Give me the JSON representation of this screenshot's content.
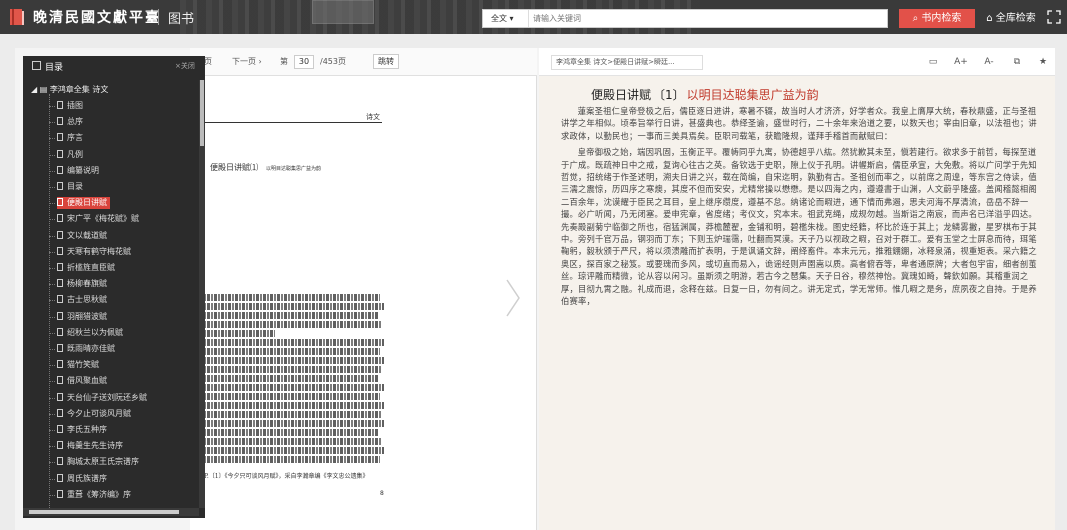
{
  "header": {
    "site_title": "晚清民國文獻平臺",
    "site_sub": "图书",
    "search_scope": "全文 ▾",
    "search_placeholder": "请输入关键词",
    "btn_search_book": "书内检索",
    "btn_search_all": "全库检索"
  },
  "reader": {
    "prev_label": "页",
    "next_label": "下一页 ›",
    "page_prefix": "第",
    "page_value": "30",
    "page_total": "/453页",
    "jump_label": "跳转"
  },
  "scan": {
    "header_text": "诗文",
    "title_text": "便殿日讲赋⑴",
    "subtitle_text": "以明目达聪集思广益为韵",
    "footnote": "P.〔1〕《今夕只可谈风月赋》，采自李瀚章编《李文忠公遗集》",
    "page_no": "8"
  },
  "text": {
    "breadcrumb": "李鸿章全集 诗文>便殿日讲赋>瞬廷...",
    "font_up": "A+",
    "font_down": "A-",
    "title_main": "便殿日讲赋",
    "title_ref": "〔1〕",
    "title_rhyme": "以明目达聪集思广益为韵",
    "paragraphs": [
      "蓮案圣祖仁皇帝登极之后，儒臣逐日进讲，寒暑不辍，故当时人才济济，好学者众。我皇上膺厚大统，春秋鼎盛，正与圣祖讲学之年相似。顷奉旨举行日讲，甚盛典也。恭绎圣谕，盛世时行，二十余年来治道之要，以数天也；宰由旧章，以法祖也；讲求政体，以勤民也；一事而三美具焉矣。臣职司载笔，获瞻隆规，谨拜手稽首而献赋曰：",
      "皇帝御极之始，端因巩固，玉衡正平。覆帱同乎九寓，协德超乎八紘。然犹歉其未至，愼若建行。欲求多于前哲，每探至道于广成。既疏神日中之戒，复询心往古之英。备钦选于史职，隙上仪于孔明。讲幄斯启，儒臣承宣，大免敷。将以广问学于先知哲觉，招统绪于作圣述明，溯夫日讲之兴，载在简编，自宋迄明，孰勤有古。圣祖创而率之，以前席之周遑，等东宫之侍读，值三濡之震惊，历四序之寒燠，其度不但而安安，尤精常操以懋懋。是以四海之内，遵遵書于山渊，人文蔚乎隆盛。盖闻稽懿相阁二百余年，沈谟耀于臣民之耳目，皇上继序缵度，遵基不怠。纳诸论而暇进，通下情而弗遏，思夫河海不厚清流，岳岳不辞一撮。必广听闻，乃无闭塞。爰申宪章，省度绪；考仪文，究本末。祖武克绳，成规勿越。当斯诣之南宸，而声名已洋溢乎四达。先奏殿副菊宁临御之所也，宿猛渊属，莽檐麓翟，金铺和明，碧檻朱栊。图史经籍，杯比於连于其上；龙鳞雾撇，星罗棋布于其中。旁列千官万品，钢羽而丁东；下则玉炉瑞霭，吐翻而冥漠。天子乃以视政之暇，召对于群工。爰有玉堂之士屏息而待，珥笔鞠躬，毅秋颁于严尺，将以须溃雕而扩表明，于是讽诵文辞，阐绎畜件。本末元元，推雅錋錋，冰释泉涌，视重矩表。采六籍之奥区，探百家之秘笈。或要瑰而多风，或切直而易入，诡谣经则声圉嵩以质。高者俯吞等，卑者通原牌；大者包宇宙，细者剖茧丝。琼评雕而精微，论从容以闲习。虽斯须之明游，若古今之琶集。天子日谷，穆然神怡。冀瑰如畸，聲欽如願。其稽重润之厚，目彻九霄之融。礼成而退，念释在兹。日复一日，勿有间之。讲无定式，学无常师。惟几暇之是务，庶夙夜之自持。于是养伯赛率，"
    ]
  },
  "toc": {
    "title": "目录",
    "close_label": "×关闭",
    "root": "李鸿章全集 诗文",
    "items": [
      "插图",
      "总序",
      "序言",
      "凡例",
      "编纂说明",
      "目录",
      "便殿日讲赋",
      "宋广平《梅花赋》赋",
      "文以载道赋",
      "天寒有鹤守梅花赋",
      "折槛旌直臣赋",
      "杨柳春旗赋",
      "古士思秋赋",
      "羽翮猎波赋",
      "绍秋兰以为佩赋",
      "既雨晴亦佳赋",
      "猫竹笑赋",
      "借风聚血赋",
      "天台仙子送刘阮还乡赋",
      "今夕止可谈风月赋",
      "李氏五种序",
      "梅羹生先生诗序",
      "胸城太原王氏宗谱序",
      "周氏族谱序",
      "重葺《筹济编》序"
    ],
    "active_index": 6
  },
  "colors": {
    "accent_red": "#d9443c",
    "topbar_bg": "#3a3a3a",
    "panel_bg": "#2b2b2b",
    "text_title_red": "#c0392b"
  }
}
